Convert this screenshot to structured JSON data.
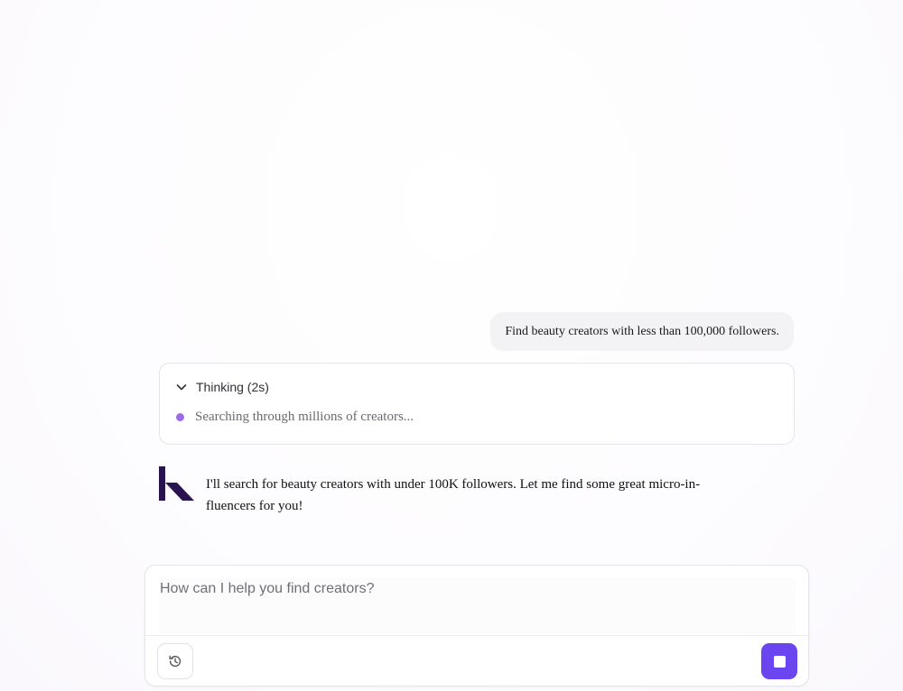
{
  "conversation": {
    "user_message": "Find beauty creators with less than 100,000 followers.",
    "thinking": {
      "label": "Thinking (2s)",
      "status_text": "Searching through millions of creators..."
    },
    "assistant_message": "I'll search for beauty creators with under 100K followers. Let me find some great micro-in-fluencers for you!"
  },
  "composer": {
    "placeholder": "How can I help you find creators?",
    "history_icon": "history-icon",
    "stop_icon": "stop-icon"
  },
  "colors": {
    "accent": "#6b46f0",
    "logo": "#2a1450",
    "thinking_dot": "#9b6bea"
  }
}
